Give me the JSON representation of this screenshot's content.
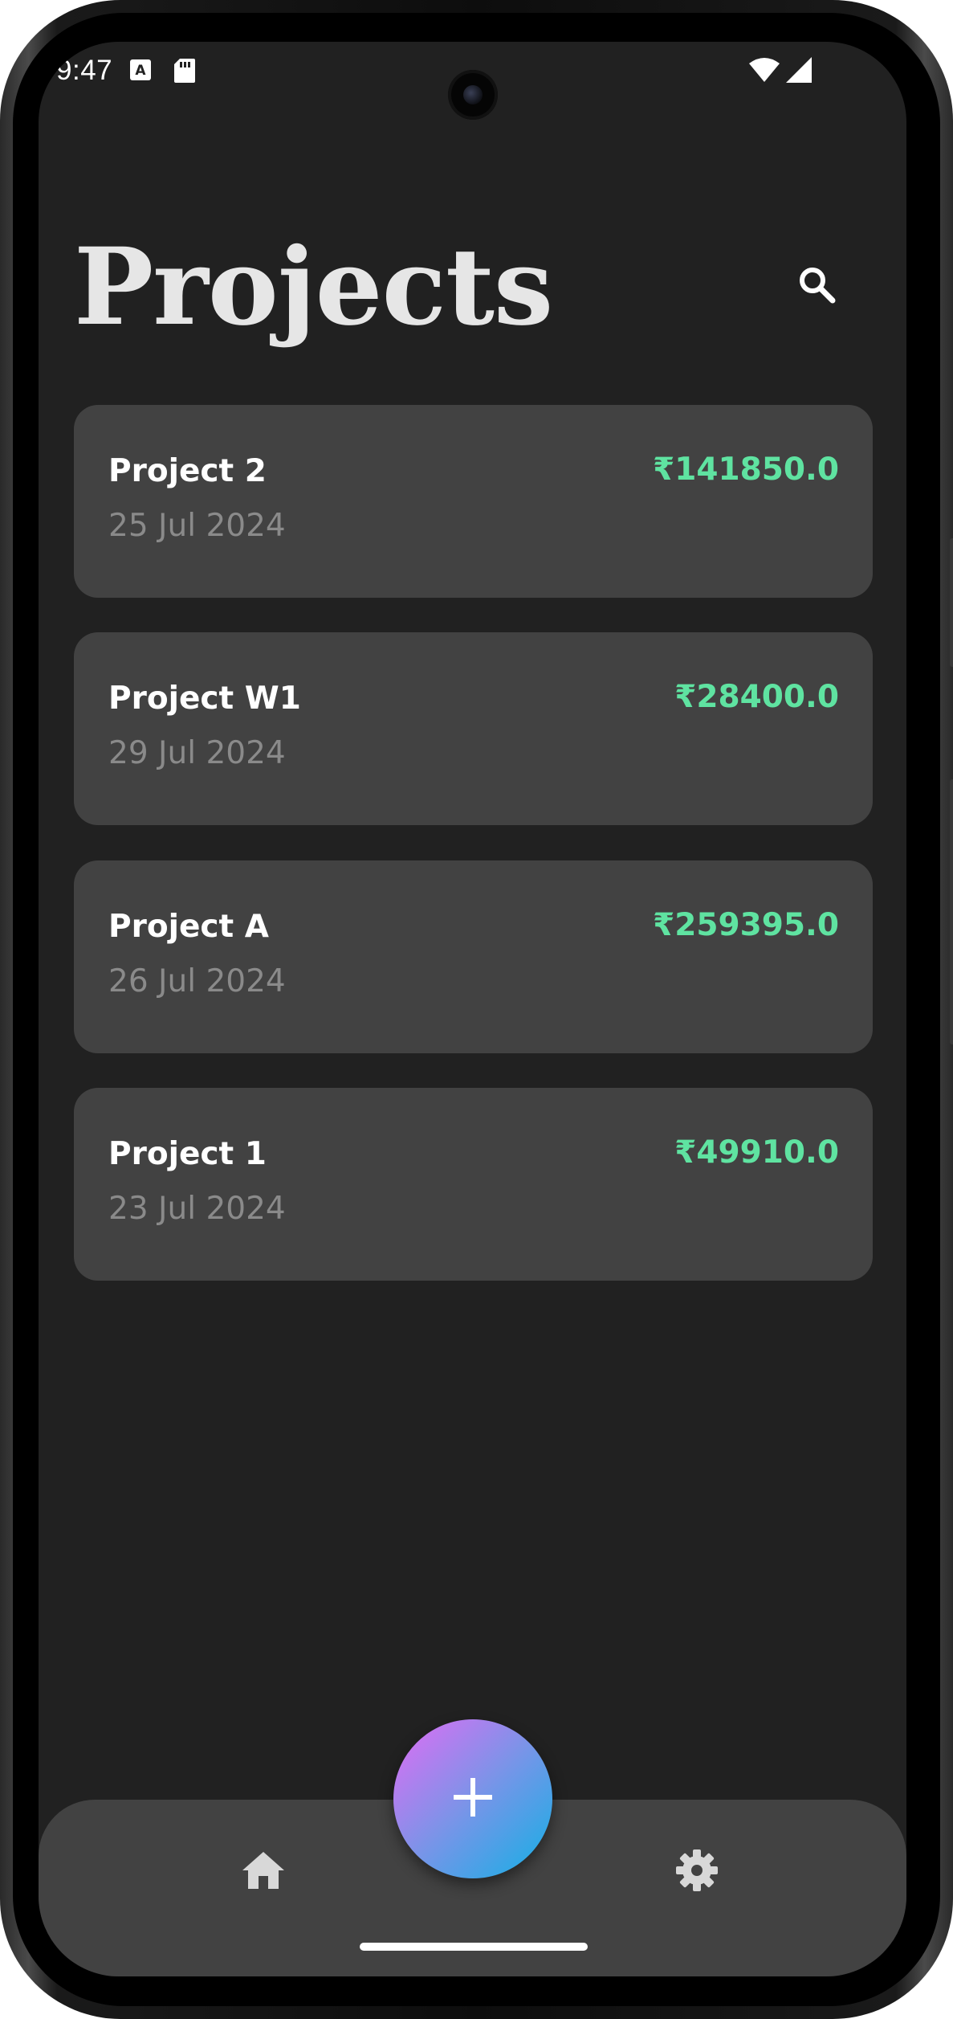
{
  "status_bar": {
    "time": "9:47",
    "icons": [
      "a-box-icon",
      "sd-card-icon",
      "wifi-icon",
      "cell-signal-icon"
    ]
  },
  "header": {
    "title": "Projects",
    "search_icon": "search-icon"
  },
  "projects": [
    {
      "name": "Project 2",
      "date": "25 Jul 2024",
      "amount": "₹141850.0"
    },
    {
      "name": "Project W1",
      "date": "29 Jul 2024",
      "amount": "₹28400.0"
    },
    {
      "name": "Project A",
      "date": "26 Jul 2024",
      "amount": "₹259395.0"
    },
    {
      "name": "Project 1",
      "date": "23 Jul 2024",
      "amount": "₹49910.0"
    }
  ],
  "bottom_nav": {
    "items": [
      "home-icon",
      "settings-icon"
    ],
    "fab_icon": "plus-icon"
  },
  "colors": {
    "background": "#212121",
    "card": "#424242",
    "amount": "#5fe3a1",
    "fab_gradient_start": "#e26cf4",
    "fab_gradient_end": "#12b0e5"
  }
}
